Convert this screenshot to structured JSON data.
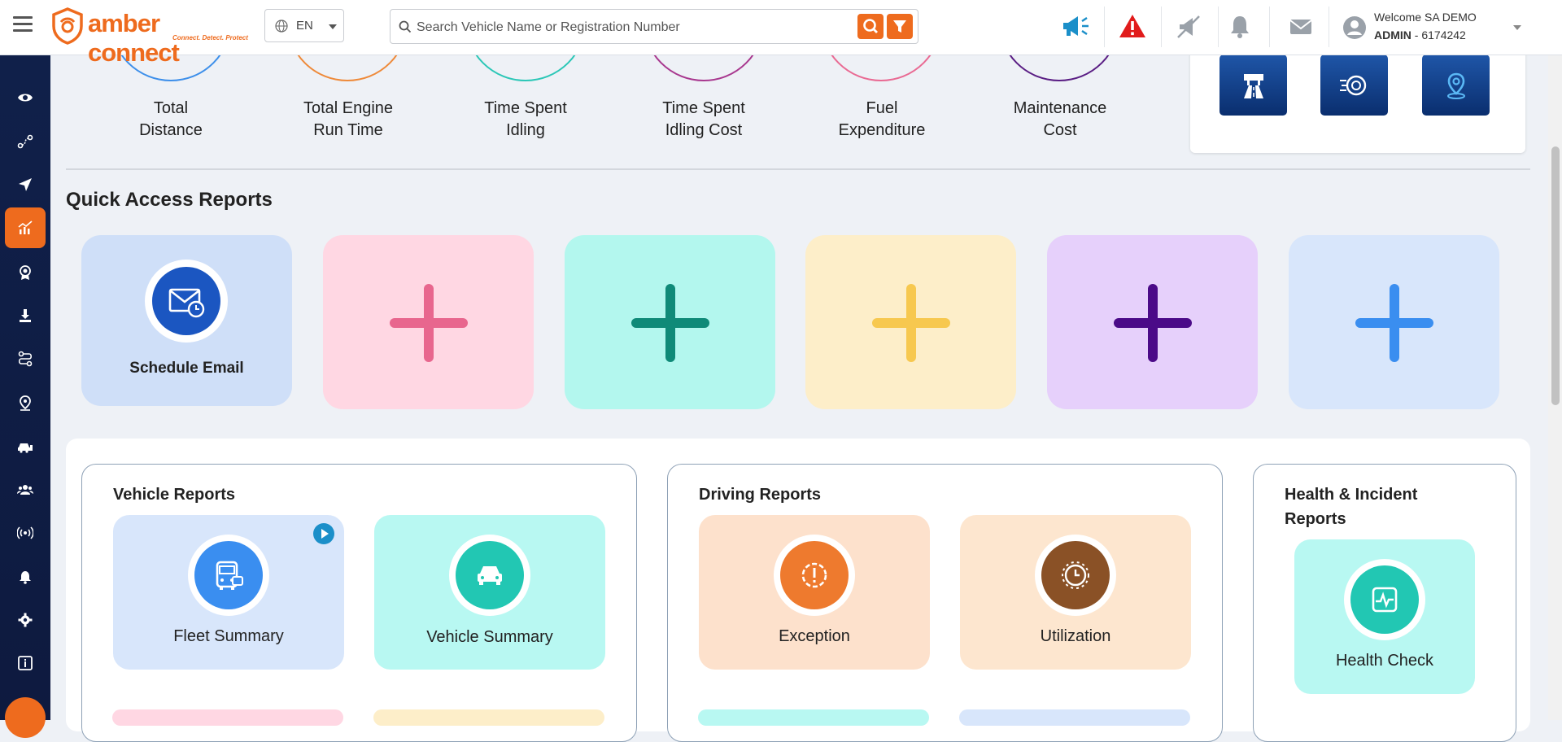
{
  "header": {
    "logo_text": "amber connect",
    "logo_tagline": "Connect. Detect. Protect",
    "language": "EN",
    "search_placeholder": "Search Vehicle Name or Registration Number",
    "user": {
      "welcome": "Welcome SA DEMO",
      "role": "ADMIN",
      "account": "6174242"
    }
  },
  "sidebar": {
    "items": [
      {
        "icon": "eye-icon"
      },
      {
        "icon": "route-icon"
      },
      {
        "icon": "navigation-arrow-icon"
      },
      {
        "icon": "analytics-chart-icon",
        "active": true
      },
      {
        "icon": "badge-icon"
      },
      {
        "icon": "download-icon"
      },
      {
        "icon": "trip-route-icon"
      },
      {
        "icon": "location-pin-icon"
      },
      {
        "icon": "vehicles-icon"
      },
      {
        "icon": "users-icon"
      },
      {
        "icon": "broadcast-icon"
      },
      {
        "icon": "alert-bell-icon"
      },
      {
        "icon": "settings-gear-icon"
      },
      {
        "icon": "info-icon"
      }
    ]
  },
  "metrics": [
    {
      "line1": "Total",
      "line2": "Distance",
      "color": "#3d8fea"
    },
    {
      "line1": "Total Engine",
      "line2": "Run Time",
      "color": "#ee8a3a"
    },
    {
      "line1": "Time Spent",
      "line2": "Idling",
      "color": "#2cc7b7"
    },
    {
      "line1": "Time Spent",
      "line2": "Idling Cost",
      "color": "#a8388f"
    },
    {
      "line1": "Fuel",
      "line2": "Expenditure",
      "color": "#e96a93"
    },
    {
      "line1": "Maintenance",
      "line2": "Cost",
      "color": "#5a1e84"
    }
  ],
  "quick_access": {
    "title": "Quick Access Reports",
    "schedule_email_label": "Schedule Email",
    "cards": [
      {
        "bg": "#cfdff8",
        "kind": "schedule-email"
      },
      {
        "bg": "#ffd7e3",
        "plus": "#e8668e"
      },
      {
        "bg": "#b3f7ee",
        "plus": "#0f8a78"
      },
      {
        "bg": "#fdeec9",
        "plus": "#f7c84f"
      },
      {
        "bg": "#e6d0fb",
        "plus": "#4b0a88"
      },
      {
        "bg": "#d8e6fb",
        "plus": "#3a8ef0"
      }
    ]
  },
  "report_groups": {
    "vehicle": {
      "title": "Vehicle Reports",
      "fleet_summary": "Fleet Summary",
      "vehicle_summary": "Vehicle Summary"
    },
    "driving": {
      "title": "Driving Reports",
      "exception": "Exception",
      "utilization": "Utilization"
    },
    "health": {
      "title_line1": "Health & Incident",
      "title_line2": "Reports",
      "health_check": "Health Check"
    }
  }
}
